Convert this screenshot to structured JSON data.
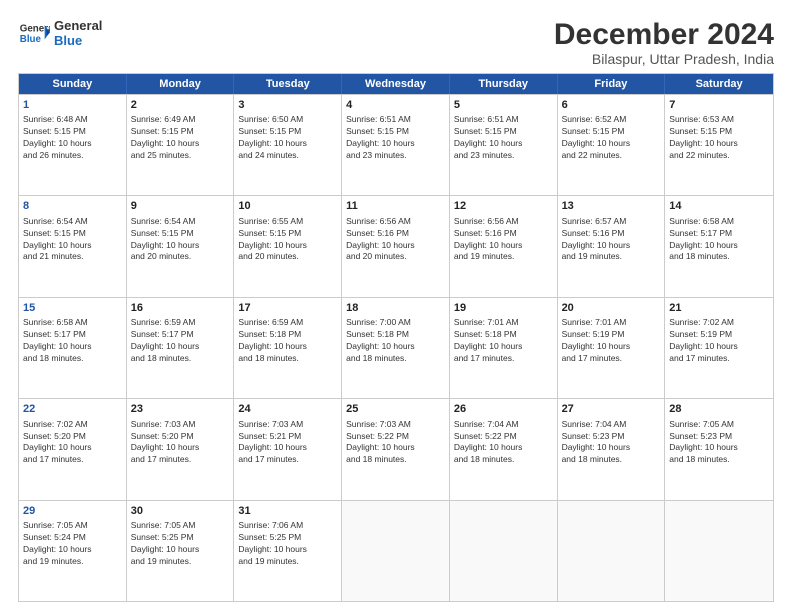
{
  "logo": {
    "line1": "General",
    "line2": "Blue"
  },
  "title": "December 2024",
  "subtitle": "Bilaspur, Uttar Pradesh, India",
  "header_days": [
    "Sunday",
    "Monday",
    "Tuesday",
    "Wednesday",
    "Thursday",
    "Friday",
    "Saturday"
  ],
  "rows": [
    [
      {
        "day": "1",
        "lines": [
          "Sunrise: 6:48 AM",
          "Sunset: 5:15 PM",
          "Daylight: 10 hours",
          "and 26 minutes."
        ],
        "empty": false,
        "sunday": true
      },
      {
        "day": "2",
        "lines": [
          "Sunrise: 6:49 AM",
          "Sunset: 5:15 PM",
          "Daylight: 10 hours",
          "and 25 minutes."
        ],
        "empty": false
      },
      {
        "day": "3",
        "lines": [
          "Sunrise: 6:50 AM",
          "Sunset: 5:15 PM",
          "Daylight: 10 hours",
          "and 24 minutes."
        ],
        "empty": false
      },
      {
        "day": "4",
        "lines": [
          "Sunrise: 6:51 AM",
          "Sunset: 5:15 PM",
          "Daylight: 10 hours",
          "and 23 minutes."
        ],
        "empty": false
      },
      {
        "day": "5",
        "lines": [
          "Sunrise: 6:51 AM",
          "Sunset: 5:15 PM",
          "Daylight: 10 hours",
          "and 23 minutes."
        ],
        "empty": false
      },
      {
        "day": "6",
        "lines": [
          "Sunrise: 6:52 AM",
          "Sunset: 5:15 PM",
          "Daylight: 10 hours",
          "and 22 minutes."
        ],
        "empty": false
      },
      {
        "day": "7",
        "lines": [
          "Sunrise: 6:53 AM",
          "Sunset: 5:15 PM",
          "Daylight: 10 hours",
          "and 22 minutes."
        ],
        "empty": false
      }
    ],
    [
      {
        "day": "8",
        "lines": [
          "Sunrise: 6:54 AM",
          "Sunset: 5:15 PM",
          "Daylight: 10 hours",
          "and 21 minutes."
        ],
        "empty": false,
        "sunday": true
      },
      {
        "day": "9",
        "lines": [
          "Sunrise: 6:54 AM",
          "Sunset: 5:15 PM",
          "Daylight: 10 hours",
          "and 20 minutes."
        ],
        "empty": false
      },
      {
        "day": "10",
        "lines": [
          "Sunrise: 6:55 AM",
          "Sunset: 5:15 PM",
          "Daylight: 10 hours",
          "and 20 minutes."
        ],
        "empty": false
      },
      {
        "day": "11",
        "lines": [
          "Sunrise: 6:56 AM",
          "Sunset: 5:16 PM",
          "Daylight: 10 hours",
          "and 20 minutes."
        ],
        "empty": false
      },
      {
        "day": "12",
        "lines": [
          "Sunrise: 6:56 AM",
          "Sunset: 5:16 PM",
          "Daylight: 10 hours",
          "and 19 minutes."
        ],
        "empty": false
      },
      {
        "day": "13",
        "lines": [
          "Sunrise: 6:57 AM",
          "Sunset: 5:16 PM",
          "Daylight: 10 hours",
          "and 19 minutes."
        ],
        "empty": false
      },
      {
        "day": "14",
        "lines": [
          "Sunrise: 6:58 AM",
          "Sunset: 5:17 PM",
          "Daylight: 10 hours",
          "and 18 minutes."
        ],
        "empty": false
      }
    ],
    [
      {
        "day": "15",
        "lines": [
          "Sunrise: 6:58 AM",
          "Sunset: 5:17 PM",
          "Daylight: 10 hours",
          "and 18 minutes."
        ],
        "empty": false,
        "sunday": true
      },
      {
        "day": "16",
        "lines": [
          "Sunrise: 6:59 AM",
          "Sunset: 5:17 PM",
          "Daylight: 10 hours",
          "and 18 minutes."
        ],
        "empty": false
      },
      {
        "day": "17",
        "lines": [
          "Sunrise: 6:59 AM",
          "Sunset: 5:18 PM",
          "Daylight: 10 hours",
          "and 18 minutes."
        ],
        "empty": false
      },
      {
        "day": "18",
        "lines": [
          "Sunrise: 7:00 AM",
          "Sunset: 5:18 PM",
          "Daylight: 10 hours",
          "and 18 minutes."
        ],
        "empty": false
      },
      {
        "day": "19",
        "lines": [
          "Sunrise: 7:01 AM",
          "Sunset: 5:18 PM",
          "Daylight: 10 hours",
          "and 17 minutes."
        ],
        "empty": false
      },
      {
        "day": "20",
        "lines": [
          "Sunrise: 7:01 AM",
          "Sunset: 5:19 PM",
          "Daylight: 10 hours",
          "and 17 minutes."
        ],
        "empty": false
      },
      {
        "day": "21",
        "lines": [
          "Sunrise: 7:02 AM",
          "Sunset: 5:19 PM",
          "Daylight: 10 hours",
          "and 17 minutes."
        ],
        "empty": false
      }
    ],
    [
      {
        "day": "22",
        "lines": [
          "Sunrise: 7:02 AM",
          "Sunset: 5:20 PM",
          "Daylight: 10 hours",
          "and 17 minutes."
        ],
        "empty": false,
        "sunday": true
      },
      {
        "day": "23",
        "lines": [
          "Sunrise: 7:03 AM",
          "Sunset: 5:20 PM",
          "Daylight: 10 hours",
          "and 17 minutes."
        ],
        "empty": false
      },
      {
        "day": "24",
        "lines": [
          "Sunrise: 7:03 AM",
          "Sunset: 5:21 PM",
          "Daylight: 10 hours",
          "and 17 minutes."
        ],
        "empty": false
      },
      {
        "day": "25",
        "lines": [
          "Sunrise: 7:03 AM",
          "Sunset: 5:22 PM",
          "Daylight: 10 hours",
          "and 18 minutes."
        ],
        "empty": false
      },
      {
        "day": "26",
        "lines": [
          "Sunrise: 7:04 AM",
          "Sunset: 5:22 PM",
          "Daylight: 10 hours",
          "and 18 minutes."
        ],
        "empty": false
      },
      {
        "day": "27",
        "lines": [
          "Sunrise: 7:04 AM",
          "Sunset: 5:23 PM",
          "Daylight: 10 hours",
          "and 18 minutes."
        ],
        "empty": false
      },
      {
        "day": "28",
        "lines": [
          "Sunrise: 7:05 AM",
          "Sunset: 5:23 PM",
          "Daylight: 10 hours",
          "and 18 minutes."
        ],
        "empty": false
      }
    ],
    [
      {
        "day": "29",
        "lines": [
          "Sunrise: 7:05 AM",
          "Sunset: 5:24 PM",
          "Daylight: 10 hours",
          "and 19 minutes."
        ],
        "empty": false,
        "sunday": true
      },
      {
        "day": "30",
        "lines": [
          "Sunrise: 7:05 AM",
          "Sunset: 5:25 PM",
          "Daylight: 10 hours",
          "and 19 minutes."
        ],
        "empty": false
      },
      {
        "day": "31",
        "lines": [
          "Sunrise: 7:06 AM",
          "Sunset: 5:25 PM",
          "Daylight: 10 hours",
          "and 19 minutes."
        ],
        "empty": false
      },
      {
        "day": "",
        "lines": [],
        "empty": true
      },
      {
        "day": "",
        "lines": [],
        "empty": true
      },
      {
        "day": "",
        "lines": [],
        "empty": true
      },
      {
        "day": "",
        "lines": [],
        "empty": true
      }
    ]
  ]
}
